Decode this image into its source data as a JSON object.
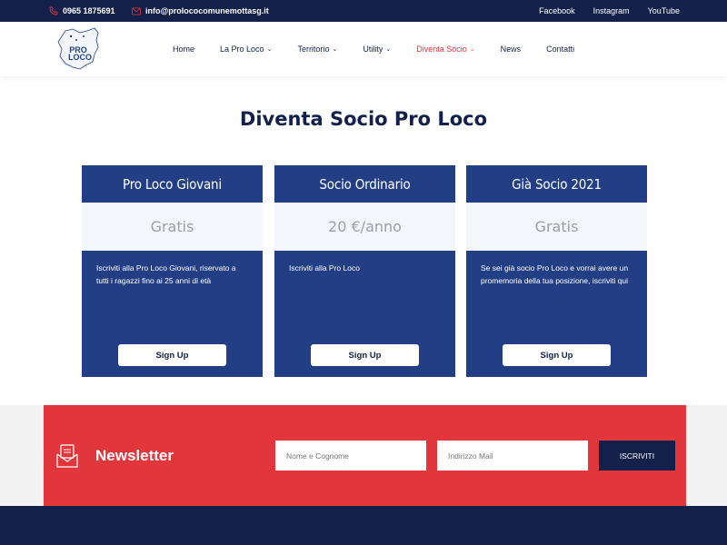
{
  "topbar": {
    "phone": "0965 1875691",
    "email": "info@prolococomunemottasg.it",
    "social": [
      "Facebook",
      "Instagram",
      "YouTube"
    ]
  },
  "nav": {
    "items": [
      {
        "label": "Home",
        "caret": false
      },
      {
        "label": "La Pro Loco",
        "caret": true
      },
      {
        "label": "Territorio",
        "caret": true
      },
      {
        "label": "Utility",
        "caret": true
      },
      {
        "label": "Diventa Socio",
        "caret": true,
        "active": true
      },
      {
        "label": "News",
        "caret": false
      },
      {
        "label": "Contatti",
        "caret": false
      }
    ]
  },
  "page": {
    "title": "Diventa Socio Pro Loco"
  },
  "cards": [
    {
      "title": "Pro Loco Giovani",
      "price": "Gratis",
      "description": "Iscriviti alla Pro Loco Giovani, riservato a tutti i ragazzi fino ai 25 anni di età",
      "button": "Sign Up"
    },
    {
      "title": "Socio Ordinario",
      "price": "20 €/anno",
      "description": "Iscriviti alla Pro Loco",
      "button": "Sign Up"
    },
    {
      "title": "Già Socio 2021",
      "price": "Gratis",
      "description": "Se sei già socio Pro Loco e vorrai avere un promemoria della tua posizione, iscriviti qui",
      "button": "Sign Up"
    }
  ],
  "newsletter": {
    "title": "Newsletter",
    "name_placeholder": "Nome e Cognome",
    "email_placeholder": "Indirizzo Mail",
    "button": "ISCRIVITI"
  },
  "colors": {
    "navy": "#13214a",
    "card_blue": "#223f86",
    "accent_red": "#e2363d"
  }
}
